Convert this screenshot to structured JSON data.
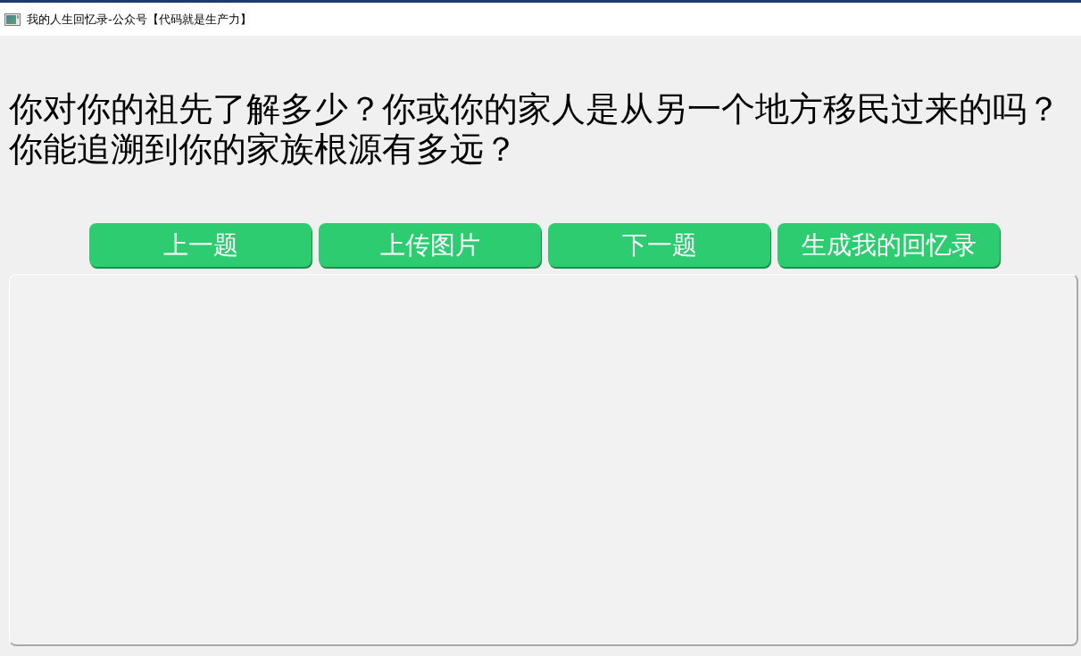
{
  "window": {
    "title": "我的人生回忆录-公众号【代码就是生产力】"
  },
  "question": "你对你的祖先了解多少？你或你的家人是从另一个地方移民过来的吗？你能追溯到你的家族根源有多远？",
  "buttons": [
    {
      "label": "上一题"
    },
    {
      "label": "上传图片"
    },
    {
      "label": "下一题"
    },
    {
      "label": "生成我的回忆录"
    }
  ]
}
